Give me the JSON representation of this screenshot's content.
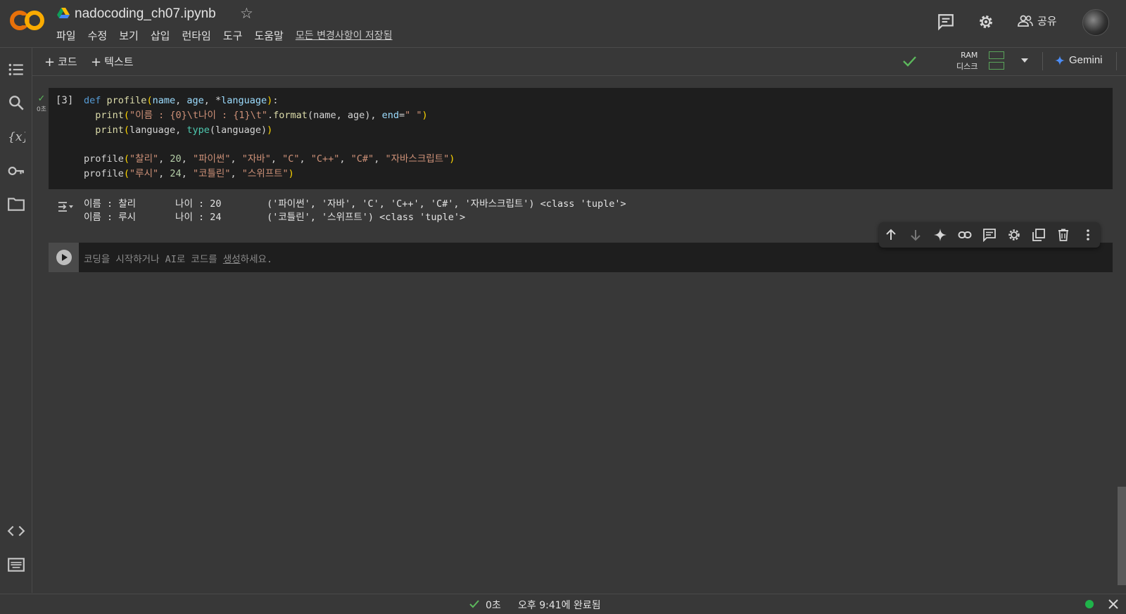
{
  "header": {
    "logo_text": "CO",
    "notebook_title": "nadocoding_ch07.ipynb",
    "menu": [
      "파일",
      "수정",
      "보기",
      "삽입",
      "런타임",
      "도구",
      "도움말"
    ],
    "saved_status": "모든 변경사항이 저장됨",
    "share_label": "공유"
  },
  "toolbar": {
    "add_code": "코드",
    "add_text": "텍스트",
    "ram_label": "RAM",
    "disk_label": "디스크",
    "gemini_label": "Gemini"
  },
  "cells": [
    {
      "execution_count": "[3]",
      "exec_time": "0초",
      "code_lines": [
        "def profile(name, age, *language):",
        "  print(\"이름 : {0}\\t나이 : {1}\\t\".format(name, age), end=\" \")",
        "  print(language, type(language))",
        "",
        "profile(\"찰리\", 20, \"파이썬\", \"자바\", \"C\", \"C++\", \"C#\", \"자바스크립트\")",
        "profile(\"루시\", 24, \"코틀린\", \"스위프트\")"
      ],
      "output_lines": [
        "이름 : 찰리\t나이 : 20\t('파이썬', '자바', 'C', 'C++', 'C#', '자바스크립트') <class 'tuple'>",
        "이름 : 루시\t나이 : 24\t('코틀린', '스위프트') <class 'tuple'>"
      ]
    }
  ],
  "empty_cell": {
    "placeholder_pre": "코딩을 시작하거나 AI로 코드를 ",
    "placeholder_link": "생성",
    "placeholder_post": "하세요."
  },
  "cell_toolbar_icons": [
    "arrow-up-icon",
    "arrow-down-icon",
    "sparkle-icon",
    "link-icon",
    "comment-icon",
    "gear-icon",
    "mirror-icon",
    "trash-icon",
    "more-vert-icon"
  ],
  "status_bar": {
    "exec_time": "0초",
    "completed_text": "오후 9:41에 완료됨",
    "connection_color": "#1fb34a"
  },
  "colors": {
    "accent_orange": "#f9ab00",
    "accent_orange_dark": "#e8710a",
    "gemini_blue": "#4c8df6"
  }
}
